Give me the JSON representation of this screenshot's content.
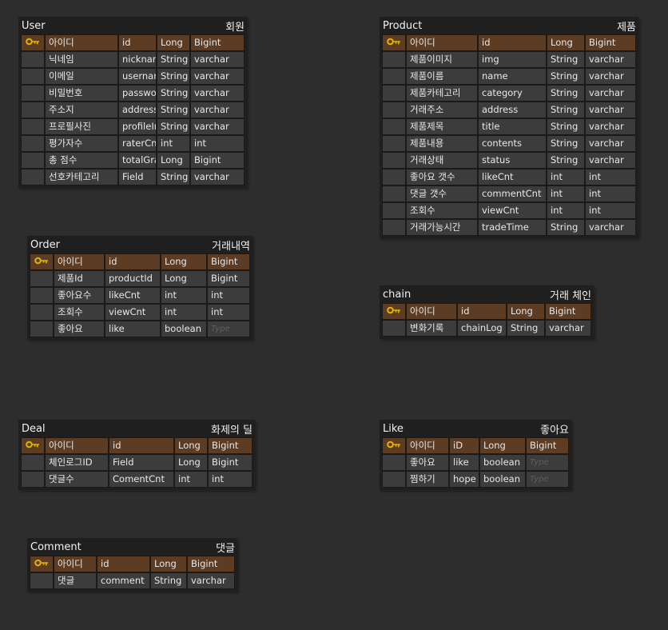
{
  "tables": [
    {
      "id": "user",
      "name": "User",
      "label": "회원",
      "cols": [
        30,
        92,
        48,
        42,
        68
      ],
      "rows": [
        {
          "pk": true,
          "k": "아이디",
          "f": "id",
          "t": "Long",
          "d": "Bigint"
        },
        {
          "k": "닉네임",
          "f": "nickname",
          "t": "String",
          "d": "varchar"
        },
        {
          "k": "이메일",
          "f": "username",
          "t": "String",
          "d": "varchar"
        },
        {
          "k": "비밀번호",
          "f": "password",
          "t": "String",
          "d": "varchar"
        },
        {
          "k": "주소지",
          "f": "address",
          "t": "String",
          "d": "varchar"
        },
        {
          "k": "프로필사진",
          "f": "profileImg",
          "t": "String",
          "d": "varchar"
        },
        {
          "k": "평가자수",
          "f": "raterCnt",
          "t": "int",
          "d": "int"
        },
        {
          "k": "총 점수",
          "f": "totalGrade",
          "t": "Long",
          "d": "Bigint"
        },
        {
          "k": "선호카테고리",
          "f": "Field",
          "t": "String",
          "d": "varchar"
        }
      ]
    },
    {
      "id": "product",
      "name": "Product",
      "label": "제품",
      "cols": [
        30,
        90,
        86,
        48,
        64
      ],
      "rows": [
        {
          "pk": true,
          "k": "아이디",
          "f": "id",
          "t": "Long",
          "d": "Bigint"
        },
        {
          "k": "제품이미지",
          "f": "img",
          "t": "String",
          "d": "varchar"
        },
        {
          "k": "제품이름",
          "f": "name",
          "t": "String",
          "d": "varchar"
        },
        {
          "k": "제품카테고리",
          "f": "category",
          "t": "String",
          "d": "varchar"
        },
        {
          "k": "거래주소",
          "f": "address",
          "t": "String",
          "d": "varchar"
        },
        {
          "k": "제품제목",
          "f": "title",
          "t": "String",
          "d": "varchar"
        },
        {
          "k": "제품내용",
          "f": "contents",
          "t": "String",
          "d": "varchar"
        },
        {
          "k": "거래상태",
          "f": "status",
          "t": "String",
          "d": "varchar"
        },
        {
          "k": "좋아요 갯수",
          "f": "likeCnt",
          "t": "int",
          "d": "int"
        },
        {
          "k": "댓글 갯수",
          "f": "commentCnt",
          "t": "int",
          "d": "int"
        },
        {
          "k": "조회수",
          "f": "viewCnt",
          "t": "int",
          "d": "int"
        },
        {
          "k": "거래가능시간",
          "f": "tradeTime",
          "t": "String",
          "d": "varchar"
        }
      ]
    },
    {
      "id": "order",
      "name": "Order",
      "label": "거래내역",
      "cols": [
        30,
        64,
        70,
        58,
        54
      ],
      "rows": [
        {
          "pk": true,
          "k": "아이디",
          "f": "id",
          "t": "Long",
          "d": "Bigint"
        },
        {
          "k": "제품Id",
          "f": "productId",
          "t": "Long",
          "d": "Bigint"
        },
        {
          "k": "좋아요수",
          "f": "likeCnt",
          "t": "int",
          "d": "int"
        },
        {
          "k": "조회수",
          "f": "viewCnt",
          "t": "int",
          "d": "int"
        },
        {
          "k": "좋아요",
          "f": "like",
          "t": "boolean",
          "d": "",
          "ph": "Type"
        }
      ]
    },
    {
      "id": "chain",
      "name": "chain",
      "label": "거래 체인",
      "cols": [
        30,
        64,
        62,
        48,
        58
      ],
      "rows": [
        {
          "pk": true,
          "k": "아이디",
          "f": "id",
          "t": "Long",
          "d": "Bigint"
        },
        {
          "k": "변화기록",
          "f": "chainLog",
          "t": "String",
          "d": "varchar"
        }
      ]
    },
    {
      "id": "deal",
      "name": "Deal",
      "label": "화제의 딜",
      "cols": [
        30,
        80,
        82,
        42,
        56
      ],
      "rows": [
        {
          "pk": true,
          "k": "아이디",
          "f": "id",
          "t": "Long",
          "d": "Bigint"
        },
        {
          "k": "체인로그ID",
          "f": "Field",
          "t": "Long",
          "d": "Bigint"
        },
        {
          "k": "댓글수",
          "f": "ComentCnt",
          "t": "int",
          "d": "int"
        }
      ]
    },
    {
      "id": "like",
      "name": "Like",
      "label": "좋아요",
      "cols": [
        30,
        54,
        38,
        58,
        54
      ],
      "rows": [
        {
          "pk": true,
          "k": "아이디",
          "f": "iD",
          "t": "Long",
          "d": "Bigint"
        },
        {
          "k": "좋아요",
          "f": "like",
          "t": "boolean",
          "d": "",
          "ph": "Type"
        },
        {
          "k": "찜하기",
          "f": "hope",
          "t": "boolean",
          "d": "",
          "ph": "Type"
        }
      ]
    },
    {
      "id": "comment",
      "name": "Comment",
      "label": "댓글",
      "cols": [
        30,
        54,
        67,
        46,
        60
      ],
      "rows": [
        {
          "pk": true,
          "k": "아이디",
          "f": "id",
          "t": "Long",
          "d": "Bigint"
        },
        {
          "k": "댓글",
          "f": "comment",
          "t": "String",
          "d": "varchar"
        }
      ]
    }
  ]
}
